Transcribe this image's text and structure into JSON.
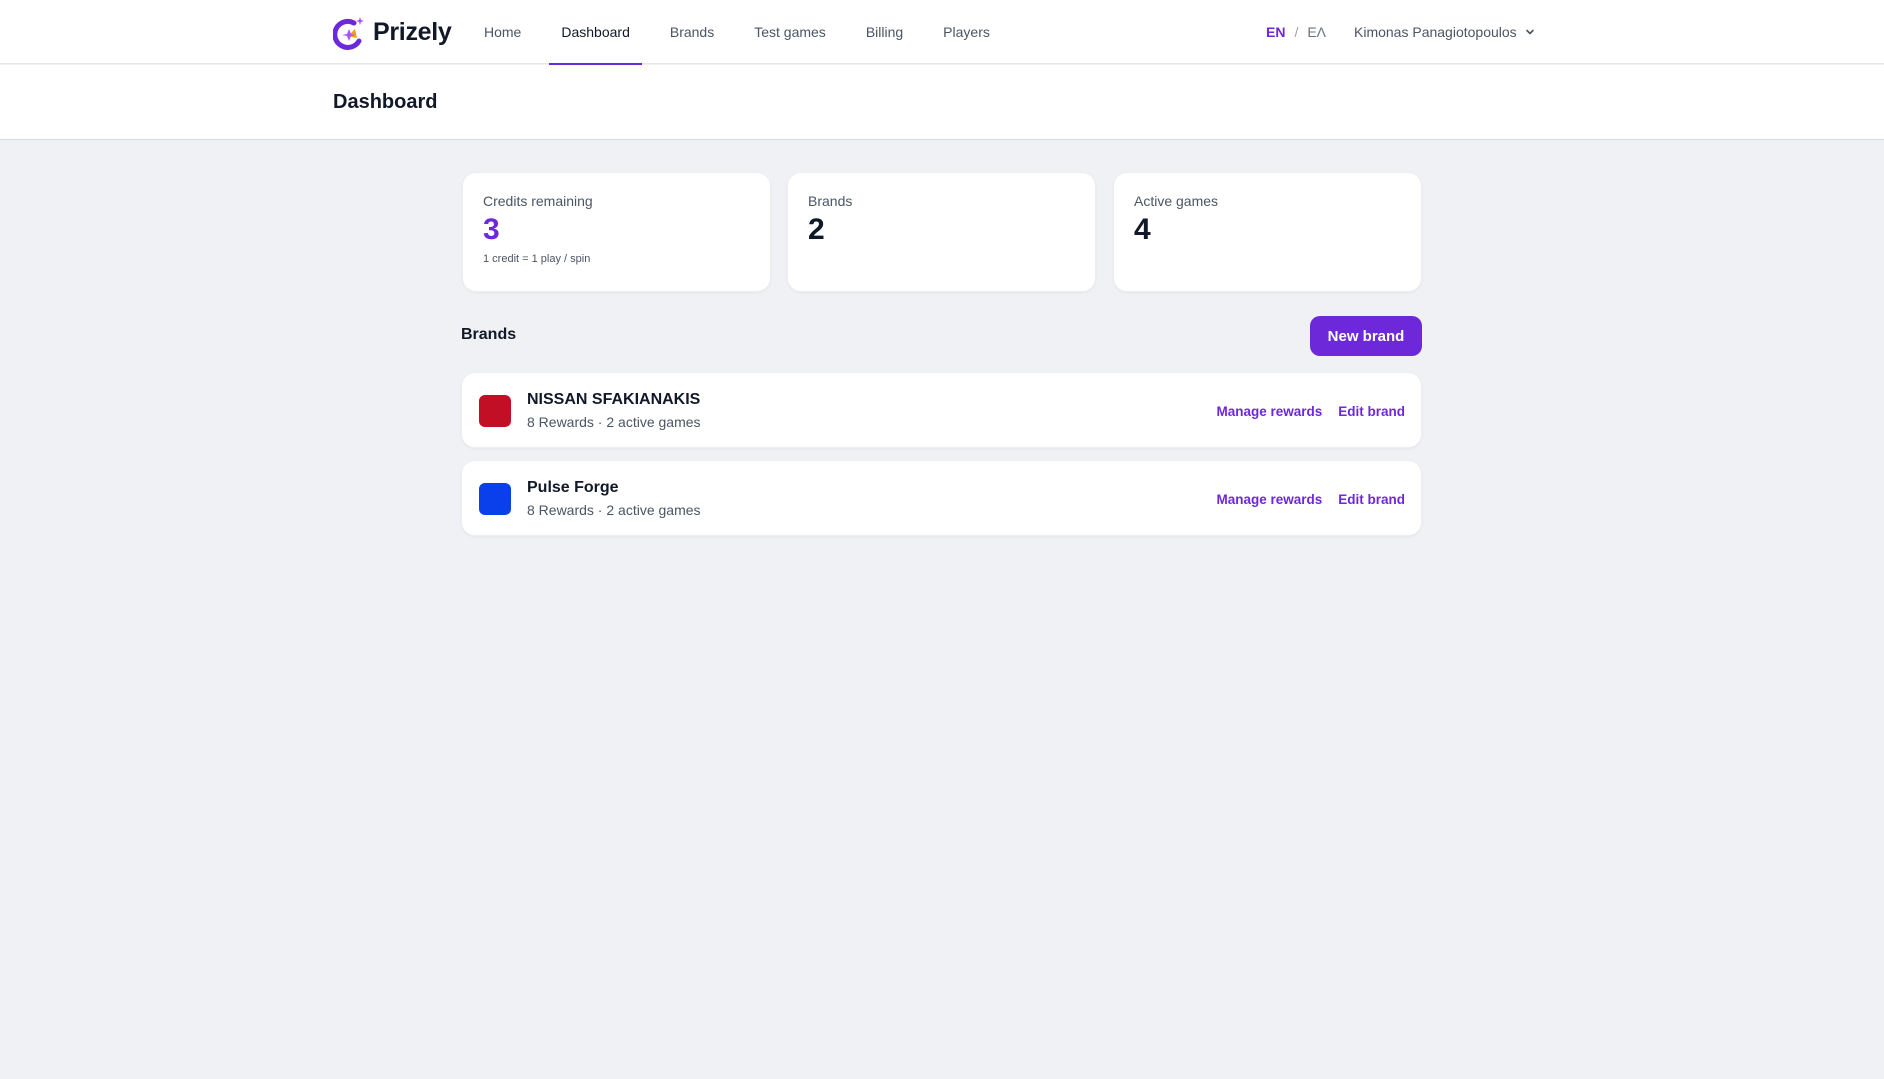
{
  "app": {
    "name": "Prizely",
    "accent_color": "#6d28d9"
  },
  "nav": {
    "items": [
      {
        "label": "Home"
      },
      {
        "label": "Dashboard"
      },
      {
        "label": "Brands"
      },
      {
        "label": "Test games"
      },
      {
        "label": "Billing"
      },
      {
        "label": "Players"
      }
    ],
    "active": "Dashboard"
  },
  "lang": {
    "en": "EN",
    "sep": "/",
    "el": "ΕΛ",
    "active": "EN"
  },
  "user": {
    "name": "Kimonas Panagiotopoulos",
    "icon": "chevron-down-icon"
  },
  "page": {
    "title": "Dashboard"
  },
  "stats": [
    {
      "label": "Credits remaining",
      "value": "3",
      "note": "1 credit = 1 play / spin"
    },
    {
      "label": "Brands",
      "value": "2"
    },
    {
      "label": "Active games",
      "value": "4"
    }
  ],
  "brands_section": {
    "title": "Brands",
    "new_button": "New brand",
    "items": [
      {
        "name": "NISSAN SFAKIANAKIS",
        "meta": "8 Rewards · 2 active games",
        "color": "#c30f25",
        "manage": "Manage rewards",
        "edit": "Edit brand"
      },
      {
        "name": "Pulse Forge",
        "meta": "8 Rewards · 2 active games",
        "color": "#0a3fec",
        "manage": "Manage rewards",
        "edit": "Edit brand"
      }
    ]
  }
}
